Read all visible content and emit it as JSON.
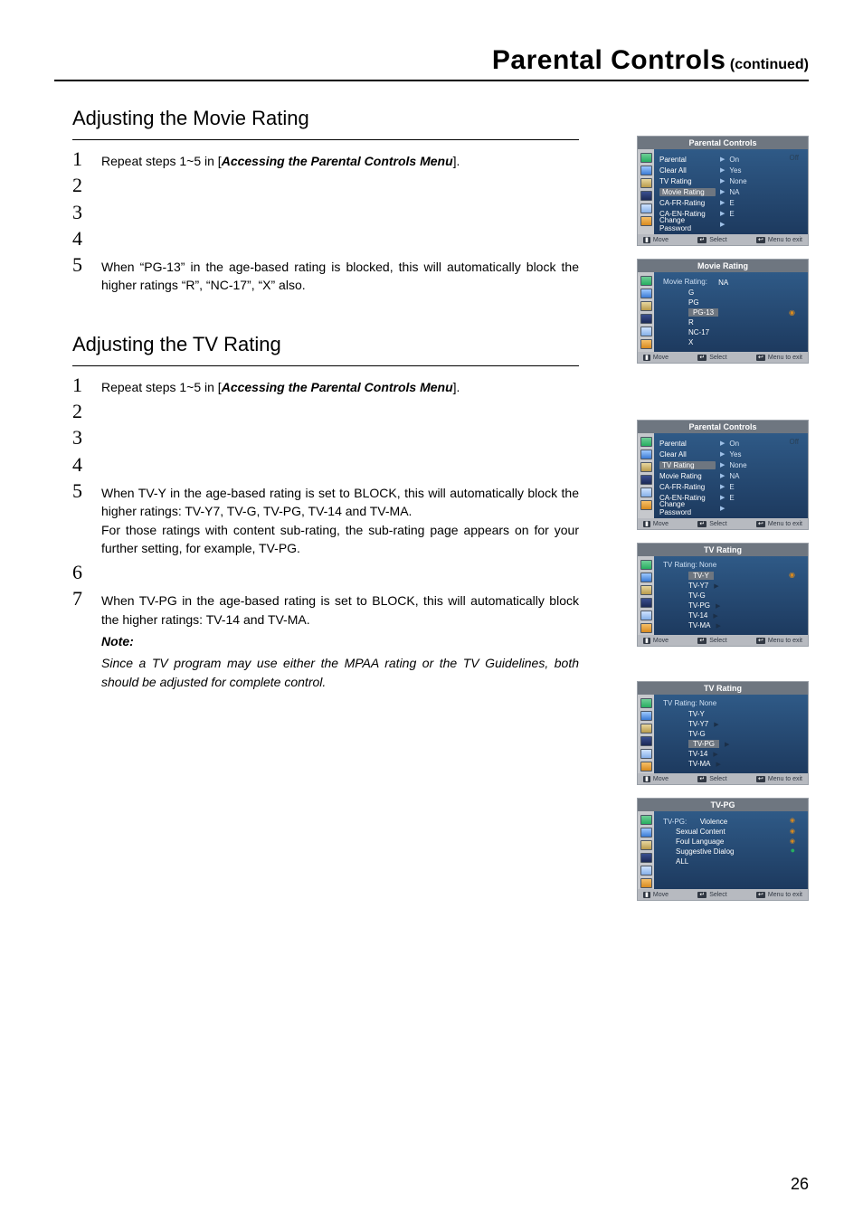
{
  "page": {
    "title_main": "Parental Controls",
    "title_sub": " (continued)",
    "number": "26"
  },
  "movie": {
    "heading": "Adjusting the Movie Rating",
    "steps": {
      "s1_pre": "Repeat steps 1~5 in [",
      "s1_em": "Accessing the Parental Controls Menu",
      "s1_post": "].",
      "s5a": "When “PG-13” in the age-based rating is blocked, this will automatically block the higher ratings “R”, “NC-17”, “X” also."
    }
  },
  "tv": {
    "heading": "Adjusting the TV Rating",
    "steps": {
      "s1_pre": "Repeat steps 1~5 in [",
      "s1_em": "Accessing the Parental Controls Menu",
      "s1_post": "].",
      "s5a": "When TV-Y in the age-based rating is set to BLOCK, this will automatically block the higher ratings: TV-Y7, TV-G, TV-PG, TV-14 and TV-MA.",
      "s5b": "For those ratings with content sub-rating, the sub-rating page appears on for your further setting, for example, TV-PG.",
      "s7a": "When TV-PG in the age-based rating is set to BLOCK, this will automatically block the higher ratings: TV-14 and TV-MA."
    },
    "note_label": "Note:",
    "note_body": "Since a TV program may use either the MPAA rating or the TV Guidelines, both should be adjusted for complete control."
  },
  "osd": {
    "footer": {
      "move": "Move",
      "select": "Select",
      "exit": "Menu to exit"
    },
    "pc": {
      "title": "Parental Controls",
      "rows": [
        {
          "lbl": "Parental",
          "val": "On",
          "off": "Off"
        },
        {
          "lbl": "Clear All",
          "val": "Yes"
        },
        {
          "lbl": "TV Rating",
          "val": "None"
        },
        {
          "lbl": "Movie Rating",
          "val": "NA"
        },
        {
          "lbl": "CA-FR-Rating",
          "val": "E"
        },
        {
          "lbl": "CA-EN-Rating",
          "val": "E"
        },
        {
          "lbl": "Change Password",
          "val": ""
        }
      ]
    },
    "mr": {
      "title": "Movie Rating",
      "leader": "Movie Rating:",
      "items": [
        "NA",
        "G",
        "PG",
        "PG-13",
        "R",
        "NC-17",
        "X"
      ],
      "selected": "PG-13"
    },
    "pc2_selected": "TV Rating",
    "tvr": {
      "title": "TV Rating",
      "leader": "TV Rating: None",
      "items": [
        "TV-Y",
        "TV-Y7",
        "TV-G",
        "TV-PG",
        "TV-14",
        "TV-MA"
      ],
      "sel1": "TV-Y",
      "sel2": "TV-PG"
    },
    "tvpg": {
      "title": "TV-PG",
      "leader": "TV-PG:",
      "items": [
        "Violence",
        "Sexual Content",
        "Foul Language",
        "Suggestive Dialog",
        "ALL"
      ]
    }
  }
}
